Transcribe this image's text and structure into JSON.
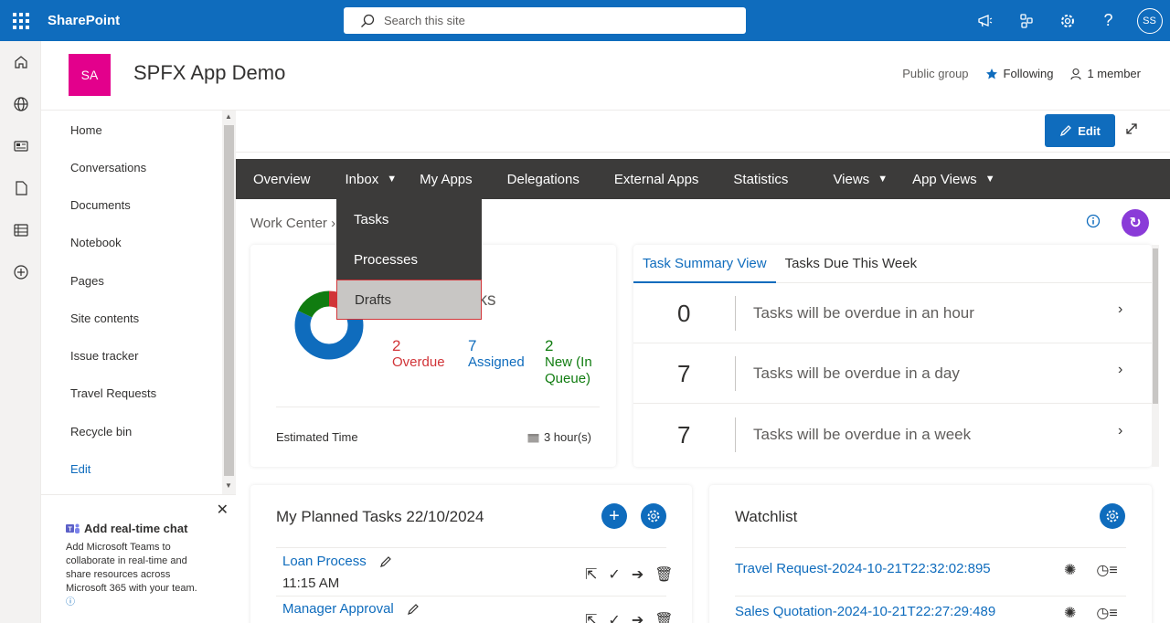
{
  "suitebar": {
    "brand": "SharePoint",
    "search_placeholder": "Search this site",
    "avatar_initials": "SS"
  },
  "site": {
    "logo": "SA",
    "title": "SPFX App Demo",
    "group": "Public group",
    "following": "Following",
    "members": "1 member"
  },
  "leftnav": {
    "items": [
      "Home",
      "Conversations",
      "Documents",
      "Notebook",
      "Pages",
      "Site contents",
      "Issue tracker",
      "Travel Requests",
      "Recycle bin"
    ],
    "edit": "Edit"
  },
  "promo": {
    "title": "Add real-time chat",
    "body": "Add Microsoft Teams to collaborate in real-time and share resources across Microsoft 365 with your team."
  },
  "toolbar": {
    "edit_label": "Edit"
  },
  "topnav": {
    "items": [
      "Overview",
      "Inbox",
      "My Apps",
      "Delegations",
      "External Apps",
      "Statistics",
      "Views",
      "App Views"
    ]
  },
  "dropdown": {
    "items": [
      "Tasks",
      "Processes",
      "Drafts"
    ]
  },
  "breadcrumb": "Work Center",
  "summary": {
    "tasks_label": "sks",
    "overdue_count": "2",
    "overdue_label": "Overdue",
    "assigned_count": "7",
    "assigned_label": "Assigned",
    "new_count": "2",
    "new_label": "New (In Queue)",
    "est_label": "Estimated Time",
    "est_value": "3 hour(s)"
  },
  "tabs": {
    "labels": [
      "Task Summary View",
      "Tasks Due This Week"
    ],
    "rows": [
      {
        "count": "0",
        "text": "Tasks will be overdue in an hour"
      },
      {
        "count": "7",
        "text": "Tasks will be overdue in a day"
      },
      {
        "count": "7",
        "text": "Tasks will be overdue in a week"
      }
    ]
  },
  "planned": {
    "title": "My Planned Tasks  22/10/2024",
    "items": [
      {
        "name": "Loan Process",
        "time": "11:15 AM"
      },
      {
        "name": "Manager Approval"
      }
    ]
  },
  "watchlist": {
    "title": "Watchlist",
    "items": [
      "Travel Request-2024-10-21T22:32:02:895",
      "Sales Quotation-2024-10-21T22:27:29:489"
    ]
  },
  "colors": {
    "suitebar": "#0f6cbd",
    "logo": "#e3008c",
    "nav": "#3c3b3a",
    "overdue": "#d13438",
    "assigned": "#0f6cbd",
    "new": "#107c10",
    "refresh": "#8a3bd8"
  },
  "chart_data": {
    "type": "pie",
    "categories": [
      "Overdue",
      "Assigned",
      "New (In Queue)"
    ],
    "values": [
      2,
      7,
      2
    ]
  }
}
